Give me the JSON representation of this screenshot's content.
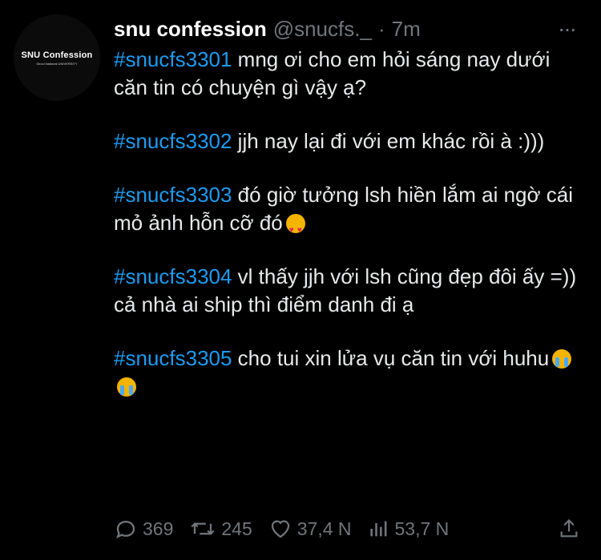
{
  "avatar": {
    "title": "SNU Confession",
    "subtitle": "Seoul National UNIVERSITY"
  },
  "header": {
    "display_name": "snu confession",
    "handle": "@snucfs._",
    "separator": "·",
    "time": "7m"
  },
  "posts": [
    {
      "tag": "#snucfs3301",
      "text": " mng ơi cho em hỏi sáng nay dưới căn tin có chuyện gì vậy ạ?"
    },
    {
      "tag": " #snucfs3302",
      "text": " jjh nay lại đi với em khác rồi à :)))"
    },
    {
      "tag": "#snucfs3303",
      "text": " đó giờ tưởng lsh hiền lắm ai ngờ cái mỏ ảnh hỗn cỡ đó",
      "emoji": [
        "heart-eyes-emoji"
      ]
    },
    {
      "tag": "#snucfs3304",
      "text": " vl thấy jjh với lsh cũng đẹp đôi ấy =)) cả nhà ai ship thì điểm danh đi ạ"
    },
    {
      "tag": "#snucfs3305",
      "text": " cho tui xin lửa vụ căn tin với huhu",
      "emoji": [
        "crying-emoji",
        "crying-emoji"
      ]
    }
  ],
  "actions": {
    "replies": "369",
    "retweets": "245",
    "likes": "37,4 N",
    "views": "53,7 N"
  }
}
